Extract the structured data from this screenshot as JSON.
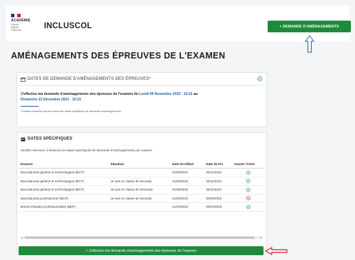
{
  "header": {
    "logo_text": "ACADÉMIE",
    "logo_sub": "Liberté Égalité Fraternité",
    "app_title": "INCLUSCOL",
    "request_button": "+ DEMANDE D'AMÉNAGEMENTS"
  },
  "page_title": "AMÉNAGEMENTS DES ÉPREUVES DE L'EXAMEN",
  "dates_card": {
    "title": "DATES DE DEMANDE D'AMÉNAGEMENTS DES ÉPREUVES*",
    "text_prefix": "J'effectue ma demande d'aménagements des épreuves de l'examen du ",
    "start": "Lundi 06 Novembre 2023 - 15:21",
    "text_mid": " au",
    "end": "Dimanche 31 Décembre 2023 - 15:21",
    "note": "*Certains examens peuvent avoir des dates spécifiques de demande d'aménagements"
  },
  "specific_card": {
    "title": "DATES SPÉCIFIQUES",
    "intro": "Veuillez retrouver ci-dessous les dates spécifiques de demande d'aménagements par examen",
    "columns": [
      "Examen",
      "Situation",
      "Date de Début",
      "Date de Fin",
      "Ouvert / Ferm"
    ],
    "rows": [
      {
        "exam": "Baccalauréat général et technologique (BGT)",
        "situation": "",
        "start": "01/03/2022",
        "end": "30/11/2022",
        "status": "open"
      },
      {
        "exam": "Baccalauréat général et technologique (BGT)",
        "situation": "Je suis en classe de seconde",
        "start": "01/03/2022",
        "end": "30/11/2022",
        "status": "open"
      },
      {
        "exam": "Baccalauréat général et technologique (BGT)",
        "situation": "Je suis en classe de terminale",
        "start": "01/09/2022",
        "end": "30/11/2022",
        "status": "open"
      },
      {
        "exam": "Baccalauréat professionnel (BCP)",
        "situation": "Je suis en classe de seconde",
        "start": "01/03/2022",
        "end": "30/09/2022",
        "status": "closed"
      },
      {
        "exam": "Brevet d'études professionnelles (BEP)",
        "situation": "",
        "start": "01/03/2022",
        "end": "03/04/2023",
        "status": "open"
      }
    ]
  },
  "bottom_button": "+ J'effectue ma demande d'aménagements des épreuves de l'examen",
  "colors": {
    "green": "#1e8a3c",
    "blue": "#1f5fa8",
    "red": "#d0202a"
  }
}
